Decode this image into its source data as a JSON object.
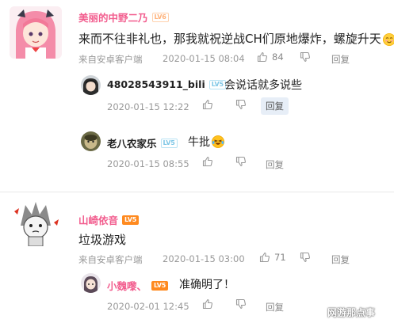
{
  "comments": [
    {
      "username": "美丽的中野二乃",
      "level": "LV6",
      "text": "来而不往非礼也，那我就祝逆战CH们原地爆炸，螺旋升天",
      "source": "来自安卓客户端",
      "datetime": "2020-01-15 08:04",
      "like_count": "84",
      "reply_label": "回复",
      "replies": [
        {
          "username": "48028543911_bili",
          "level": "LV5",
          "text": "会说话就多说些",
          "datetime": "2020-01-15 12:22",
          "reply_label": "回复"
        },
        {
          "username": "老八农家乐",
          "level": "LV5",
          "text": "牛批",
          "datetime": "2020-01-15 08:55",
          "reply_label": "回复"
        }
      ]
    },
    {
      "username": "山崎依音",
      "level": "LV5",
      "text": "垃圾游戏",
      "source": "来自安卓客户端",
      "datetime": "2020-01-15 03:00",
      "like_count": "71",
      "reply_label": "回复",
      "replies": [
        {
          "username": "小魏嚟、",
          "level": "LV5",
          "text": "准确明了！",
          "datetime": "2020-02-01 12:45",
          "reply_label": "回复"
        }
      ]
    }
  ],
  "watermark": "网游那点事",
  "colors": {
    "username_pink": "#f25d8e",
    "level_orange": "#ff8a1f",
    "reply_highlight": "#e7eef7"
  }
}
